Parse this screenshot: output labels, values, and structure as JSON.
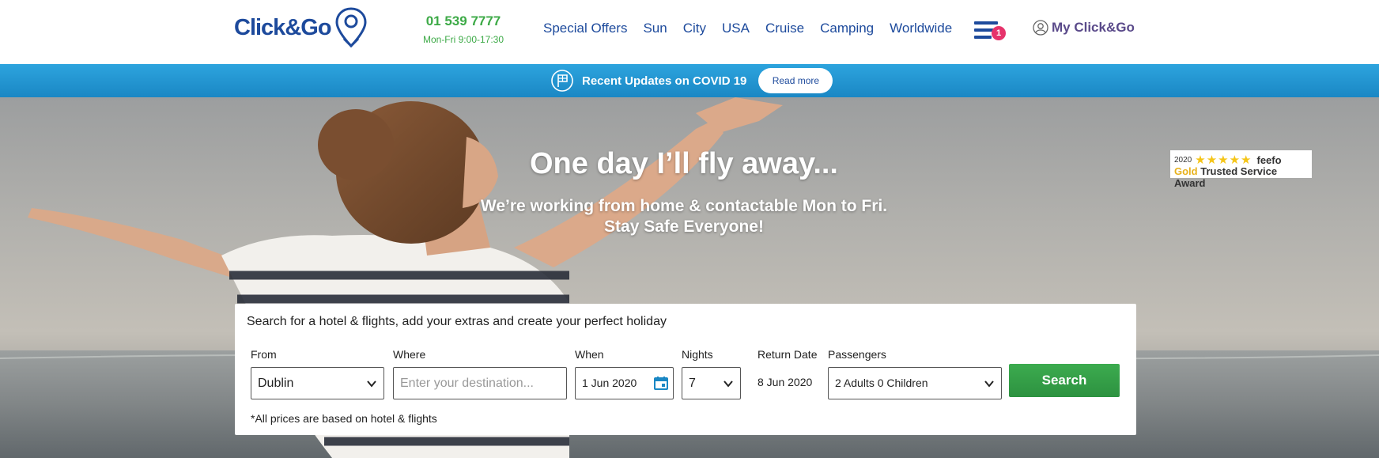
{
  "header": {
    "logo_text": "Click&Go",
    "phone_number": "01 539 7777",
    "phone_hours": "Mon-Fri 9:00-17:30",
    "nav": [
      "Special Offers",
      "Sun",
      "City",
      "USA",
      "Cruise",
      "Camping",
      "Worldwide"
    ],
    "menu_badge": "1",
    "account_label": "My Click&Go"
  },
  "covid_bar": {
    "text": "Recent Updates on COVID 19",
    "button": "Read more"
  },
  "hero": {
    "title": "One day I’ll fly away...",
    "subtitle_line1": "We’re working from home & contactable Mon to Fri.",
    "subtitle_line2": "Stay Safe Everyone!"
  },
  "feefo": {
    "year": "2020",
    "stars": "★★★★★",
    "brand": "feefo",
    "gold": "Gold",
    "award": "Trusted Service Award"
  },
  "search": {
    "intro": "Search for a hotel & flights, add your extras and create your perfect holiday",
    "from_label": "From",
    "from_value": "Dublin",
    "where_label": "Where",
    "where_placeholder": "Enter your destination...",
    "when_label": "When",
    "when_value": "1 Jun 2020",
    "nights_label": "Nights",
    "nights_value": "7",
    "return_label": "Return Date",
    "return_value": "8 Jun 2020",
    "passengers_label": "Passengers",
    "passengers_value": "2 Adults 0 Children",
    "search_button": "Search",
    "note": "*All prices are based on hotel & flights"
  },
  "colors": {
    "brand_blue": "#1d4a9c",
    "phone_green": "#3daa47",
    "covid_blue": "#2196d3",
    "search_green": "#2d9240",
    "badge_pink": "#e6336b"
  }
}
